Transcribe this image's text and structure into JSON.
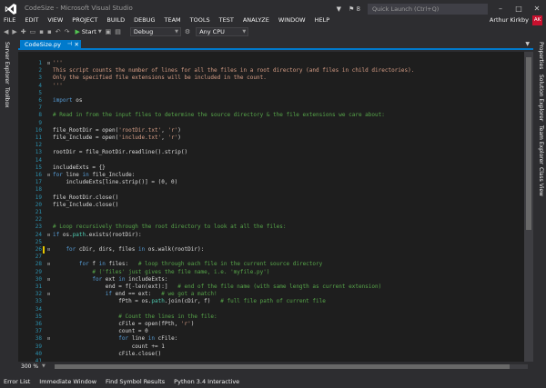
{
  "window": {
    "title": "CodeSize - Microsoft Visual Studio",
    "notification_count": "8",
    "quick_launch_placeholder": "Quick Launch (Ctrl+Q)"
  },
  "menu": {
    "items": [
      "FILE",
      "EDIT",
      "VIEW",
      "PROJECT",
      "BUILD",
      "DEBUG",
      "TEAM",
      "TOOLS",
      "TEST",
      "ANALYZE",
      "WINDOW",
      "HELP"
    ]
  },
  "user": {
    "name": "Arthur Kirkby",
    "initials": "AK",
    "avatar_color": "#c8102e"
  },
  "toolbar": {
    "start_label": "Start",
    "configuration": "Debug",
    "platform": "Any CPU"
  },
  "left_rail": {
    "tabs": [
      "Server Explorer",
      "Toolbox"
    ]
  },
  "right_rail": {
    "tabs": [
      "Properties",
      "Solution Explorer",
      "Team Explorer",
      "Class View"
    ]
  },
  "document": {
    "tab_label": "CodeSize.py",
    "accent_color": "#007acc"
  },
  "editor": {
    "zoom": "300 %",
    "lines": [
      {
        "n": "1",
        "fold": "⊟",
        "segs": [
          {
            "t": "'''",
            "c": "str"
          }
        ]
      },
      {
        "n": "2",
        "fold": "",
        "segs": [
          {
            "t": "This script counts the number of lines for all the files in a root directory (and files in child directories).",
            "c": "str"
          }
        ]
      },
      {
        "n": "3",
        "fold": "",
        "segs": [
          {
            "t": "Only the specified file extensions will be included in the count.",
            "c": "str"
          }
        ]
      },
      {
        "n": "4",
        "fold": "",
        "segs": [
          {
            "t": "'''",
            "c": "str"
          }
        ]
      },
      {
        "n": "5",
        "fold": "",
        "segs": []
      },
      {
        "n": "6",
        "fold": "",
        "segs": [
          {
            "t": "import",
            "c": "kw"
          },
          {
            "t": " os",
            "c": "pl"
          }
        ]
      },
      {
        "n": "7",
        "fold": "",
        "segs": []
      },
      {
        "n": "8",
        "fold": "",
        "segs": [
          {
            "t": "# Read in from the input files to determine the source directory & the file extensions we care about:",
            "c": "cm"
          }
        ]
      },
      {
        "n": "9",
        "fold": "",
        "segs": []
      },
      {
        "n": "10",
        "fold": "",
        "segs": [
          {
            "t": "file_RootDir = open(",
            "c": "pl"
          },
          {
            "t": "'rootDir.txt'",
            "c": "str"
          },
          {
            "t": ", ",
            "c": "pl"
          },
          {
            "t": "'r'",
            "c": "str"
          },
          {
            "t": ")",
            "c": "pl"
          }
        ]
      },
      {
        "n": "11",
        "fold": "",
        "segs": [
          {
            "t": "file_Include = open(",
            "c": "pl"
          },
          {
            "t": "'include.txt'",
            "c": "str"
          },
          {
            "t": ", ",
            "c": "pl"
          },
          {
            "t": "'r'",
            "c": "str"
          },
          {
            "t": ")",
            "c": "pl"
          }
        ]
      },
      {
        "n": "12",
        "fold": "",
        "segs": []
      },
      {
        "n": "13",
        "fold": "",
        "segs": [
          {
            "t": "rootDir = file_RootDir.readline().strip()",
            "c": "pl"
          }
        ]
      },
      {
        "n": "14",
        "fold": "",
        "segs": []
      },
      {
        "n": "15",
        "fold": "",
        "segs": [
          {
            "t": "includeExts = {}",
            "c": "pl"
          }
        ]
      },
      {
        "n": "16",
        "fold": "⊟",
        "segs": [
          {
            "t": "for",
            "c": "kw"
          },
          {
            "t": " line ",
            "c": "pl"
          },
          {
            "t": "in",
            "c": "kw"
          },
          {
            "t": " file_Include:",
            "c": "pl"
          }
        ]
      },
      {
        "n": "17",
        "fold": "",
        "segs": [
          {
            "t": "    includeExts[line.strip()] = (0, 0)",
            "c": "pl"
          }
        ]
      },
      {
        "n": "18",
        "fold": "",
        "segs": []
      },
      {
        "n": "19",
        "fold": "",
        "segs": [
          {
            "t": "file_RootDir.close()",
            "c": "pl"
          }
        ]
      },
      {
        "n": "20",
        "fold": "",
        "segs": [
          {
            "t": "file_Include.close()",
            "c": "pl"
          }
        ]
      },
      {
        "n": "21",
        "fold": "",
        "segs": []
      },
      {
        "n": "22",
        "fold": "",
        "segs": []
      },
      {
        "n": "23",
        "fold": "",
        "segs": [
          {
            "t": "# Loop recursively through the root directory to look at all the files:",
            "c": "cm"
          }
        ]
      },
      {
        "n": "24",
        "fold": "⊟",
        "segs": [
          {
            "t": "if",
            "c": "kw"
          },
          {
            "t": " os.",
            "c": "pl"
          },
          {
            "t": "path",
            "c": "bi"
          },
          {
            "t": ".exists(rootDir):",
            "c": "pl"
          }
        ]
      },
      {
        "n": "25",
        "fold": "",
        "segs": []
      },
      {
        "n": "26",
        "fold": "⊟",
        "segs": [
          {
            "t": "    for",
            "c": "kw"
          },
          {
            "t": " cDir, dirs, files ",
            "c": "pl"
          },
          {
            "t": "in",
            "c": "kw"
          },
          {
            "t": " os.walk(rootDir):",
            "c": "pl"
          }
        ]
      },
      {
        "n": "27",
        "fold": "",
        "segs": []
      },
      {
        "n": "28",
        "fold": "⊟",
        "segs": [
          {
            "t": "        for",
            "c": "kw"
          },
          {
            "t": " f ",
            "c": "pl"
          },
          {
            "t": "in",
            "c": "kw"
          },
          {
            "t": " files:   ",
            "c": "pl"
          },
          {
            "t": "# loop through each file in the current source directory",
            "c": "cm"
          }
        ]
      },
      {
        "n": "29",
        "fold": "",
        "segs": [
          {
            "t": "            # ('files' just gives the file name, i.e. 'myfile.py')",
            "c": "cm"
          }
        ]
      },
      {
        "n": "30",
        "fold": "⊟",
        "segs": [
          {
            "t": "            for",
            "c": "kw"
          },
          {
            "t": " ext ",
            "c": "pl"
          },
          {
            "t": "in",
            "c": "kw"
          },
          {
            "t": " includeExts:",
            "c": "pl"
          }
        ]
      },
      {
        "n": "31",
        "fold": "",
        "segs": [
          {
            "t": "                end = f[-len(ext):]   ",
            "c": "pl"
          },
          {
            "t": "# end of the file name (with same length as current extension)",
            "c": "cm"
          }
        ]
      },
      {
        "n": "32",
        "fold": "⊟",
        "segs": [
          {
            "t": "                if",
            "c": "kw"
          },
          {
            "t": " end == ext:   ",
            "c": "pl"
          },
          {
            "t": "# we got a match!",
            "c": "cm"
          }
        ]
      },
      {
        "n": "33",
        "fold": "",
        "segs": [
          {
            "t": "                    fPth = os.",
            "c": "pl"
          },
          {
            "t": "path",
            "c": "bi"
          },
          {
            "t": ".join(cDir, f)   ",
            "c": "pl"
          },
          {
            "t": "# full file path of current file",
            "c": "cm"
          }
        ]
      },
      {
        "n": "34",
        "fold": "",
        "segs": []
      },
      {
        "n": "35",
        "fold": "",
        "segs": [
          {
            "t": "                    # Count the lines in the file:",
            "c": "cm"
          }
        ]
      },
      {
        "n": "36",
        "fold": "",
        "segs": [
          {
            "t": "                    cFile = open(fPth, ",
            "c": "pl"
          },
          {
            "t": "'r'",
            "c": "str"
          },
          {
            "t": ")",
            "c": "pl"
          }
        ]
      },
      {
        "n": "37",
        "fold": "",
        "segs": [
          {
            "t": "                    count = 0",
            "c": "pl"
          }
        ]
      },
      {
        "n": "38",
        "fold": "⊟",
        "segs": [
          {
            "t": "                    for",
            "c": "kw"
          },
          {
            "t": " line ",
            "c": "pl"
          },
          {
            "t": "in",
            "c": "kw"
          },
          {
            "t": " cFile:",
            "c": "pl"
          }
        ]
      },
      {
        "n": "39",
        "fold": "",
        "segs": [
          {
            "t": "                        count += 1",
            "c": "pl"
          }
        ]
      },
      {
        "n": "40",
        "fold": "",
        "segs": [
          {
            "t": "                    cFile.close()",
            "c": "pl"
          }
        ]
      },
      {
        "n": "41",
        "fold": "",
        "segs": []
      }
    ],
    "changed_lines": [
      "26"
    ],
    "changed_color": "#e5c700",
    "line_number_color": "#2b91af",
    "comment_color": "#57a64a",
    "string_color": "#d69d85",
    "keyword_color": "#569cd6"
  },
  "bottom_tabs": [
    "Error List",
    "Immediate Window",
    "Find Symbol Results",
    "Python 3.4 Interactive"
  ]
}
